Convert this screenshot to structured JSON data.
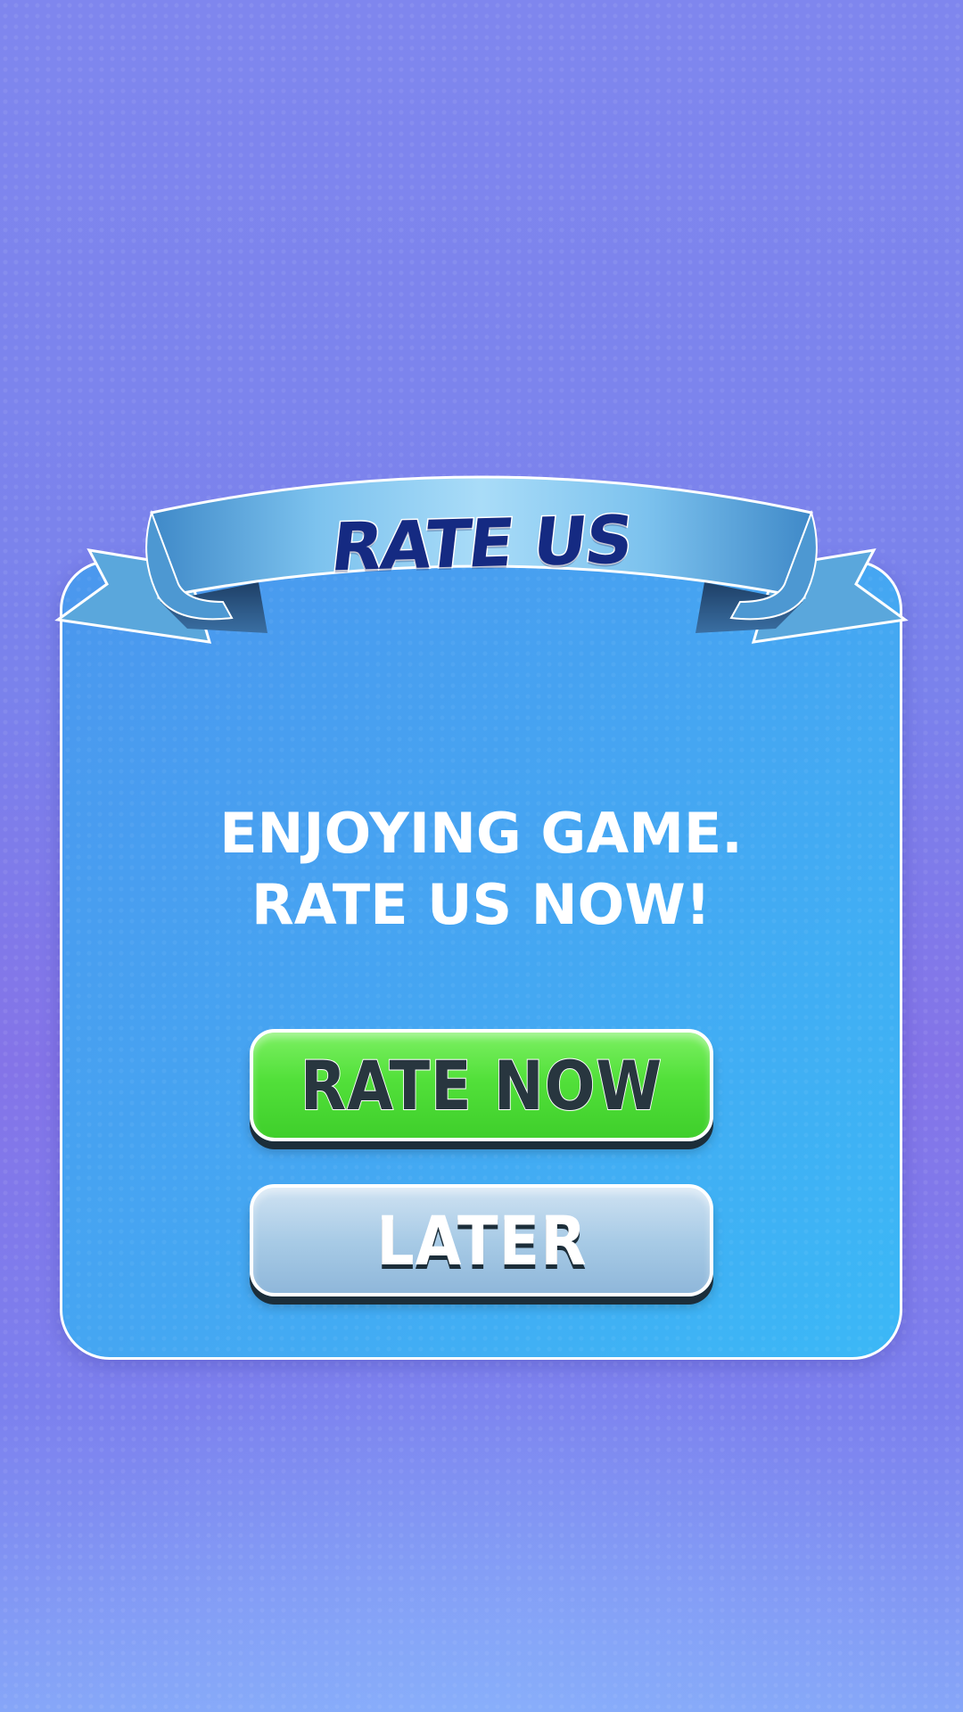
{
  "dialog": {
    "title": "RATE US",
    "message_line1": "ENJOYING GAME.",
    "message_line2": "RATE US NOW!",
    "rate_button_label": "RATE NOW",
    "later_button_label": "LATER"
  },
  "colors": {
    "background_top": "#7f86ee",
    "background_bottom": "#86a6f8",
    "panel_left": "#4b97ee",
    "panel_right": "#3bb8f6",
    "ribbon": "#6ab8ea",
    "title_text": "#152a82",
    "rate_button": "#52e03a",
    "later_button": "#a8cbe6",
    "button_text_dark": "#28363f"
  }
}
